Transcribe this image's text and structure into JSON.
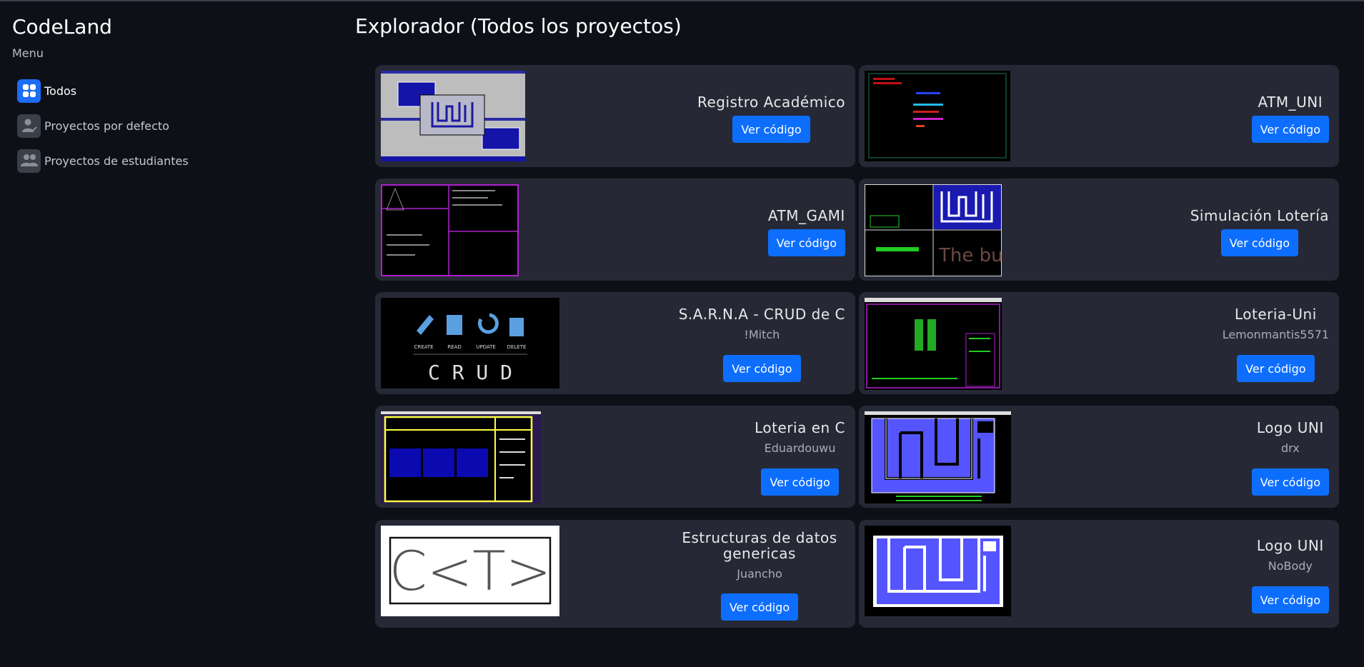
{
  "app": {
    "brand": "CodeLand",
    "menu_label": "Menu"
  },
  "sidebar": {
    "items": [
      {
        "label": "Todos",
        "icon": "grid-icon",
        "active": true
      },
      {
        "label": "Proyectos por defecto",
        "icon": "user-check-icon",
        "active": false
      },
      {
        "label": "Proyectos de estudiantes",
        "icon": "users-icon",
        "active": false
      }
    ]
  },
  "page": {
    "title": "Explorador (Todos los proyectos)"
  },
  "projects": [
    {
      "title": "Registro Académico",
      "author": "",
      "button": "Ver código",
      "thumbnail": "registro-academico-screenshot"
    },
    {
      "title": "ATM_UNI",
      "author": "",
      "button": "Ver código",
      "thumbnail": "atm-uni-screenshot"
    },
    {
      "title": "ATM_GAMI",
      "author": "",
      "button": "Ver código",
      "thumbnail": "atm-gami-screenshot"
    },
    {
      "title": "Simulación Lotería",
      "author": "",
      "button": "Ver código",
      "thumbnail": "simulacion-loteria-screenshot"
    },
    {
      "title": "S.A.R.N.A - CRUD de C",
      "author": "!Mitch",
      "button": "Ver código",
      "thumbnail": "crud-image",
      "thumb_labels": [
        "CREATE",
        "READ",
        "UPDATE",
        "DELETE"
      ],
      "thumb_text": "C R U D"
    },
    {
      "title": "Loteria-Uni",
      "author": "Lemonmantis5571",
      "button": "Ver código",
      "thumbnail": "loteria-uni-screenshot"
    },
    {
      "title": "Loteria en C",
      "author": "Eduardouwu",
      "button": "Ver código",
      "thumbnail": "loteria-en-c-screenshot"
    },
    {
      "title": "Logo UNI",
      "author": "drx",
      "button": "Ver código",
      "thumbnail": "logo-uni-console-screenshot"
    },
    {
      "title": "Estructuras de datos genericas",
      "author": "Juancho",
      "button": "Ver código",
      "thumbnail": "ct-logo-image",
      "thumb_text": "C<T>"
    },
    {
      "title": "Logo UNI",
      "author": "NoBody",
      "button": "Ver código",
      "thumbnail": "logo-uni-image"
    }
  ],
  "colors": {
    "background": "#0d1117",
    "card": "#262935",
    "accent": "#0d6efd",
    "uni_blue": "#5555ff"
  }
}
